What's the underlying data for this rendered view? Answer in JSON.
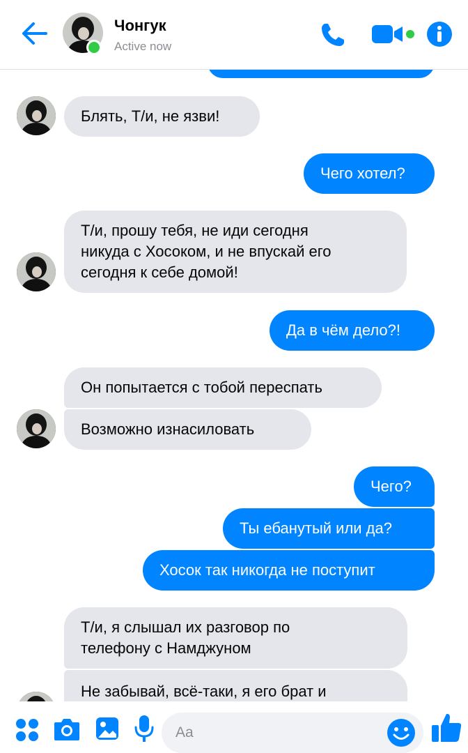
{
  "header": {
    "contact_name": "Чонгук",
    "status": "Active now"
  },
  "messages": [
    {
      "id": 1,
      "direction": "incoming",
      "text": "Блять, Т/и, не язви!"
    },
    {
      "id": 2,
      "direction": "outgoing",
      "text": "Чего хотел?"
    },
    {
      "id": 3,
      "direction": "incoming",
      "lines": [
        "Т/и, прошу тебя, не иди сегодня",
        "никуда с Хосоком, и не впускай его",
        "сегодня к себе домой!"
      ]
    },
    {
      "id": 4,
      "direction": "outgoing",
      "text": "Да в чём дело?!"
    },
    {
      "id": 5,
      "direction": "incoming",
      "text": "Он попытается с тобой переспать"
    },
    {
      "id": 6,
      "direction": "incoming",
      "text": "Возможно изнасиловать"
    },
    {
      "id": 7,
      "direction": "outgoing",
      "text": "Чего?"
    },
    {
      "id": 8,
      "direction": "outgoing",
      "text": "Ты ебанутый или да?"
    },
    {
      "id": 9,
      "direction": "outgoing",
      "text": "Хосок так никогда не поступит"
    },
    {
      "id": 10,
      "direction": "incoming",
      "lines": [
        "Т/и, я слышал их разговор по",
        "телефону с Намджуном"
      ]
    },
    {
      "id": 11,
      "direction": "incoming",
      "text": "Не забывай, всё-таки, я его брат и"
    }
  ],
  "composer": {
    "placeholder": "Aa"
  },
  "icons": {
    "header": [
      "back-arrow-icon",
      "phone-icon",
      "video-camera-icon",
      "info-icon"
    ],
    "composer": [
      "apps-grid-icon",
      "camera-icon",
      "gallery-image-icon",
      "microphone-icon",
      "emoji-icon",
      "thumbs-up-icon"
    ]
  },
  "colors": {
    "accent": "#0084ff",
    "incoming_bubble": "#e4e6eb",
    "online": "#31cc46"
  }
}
